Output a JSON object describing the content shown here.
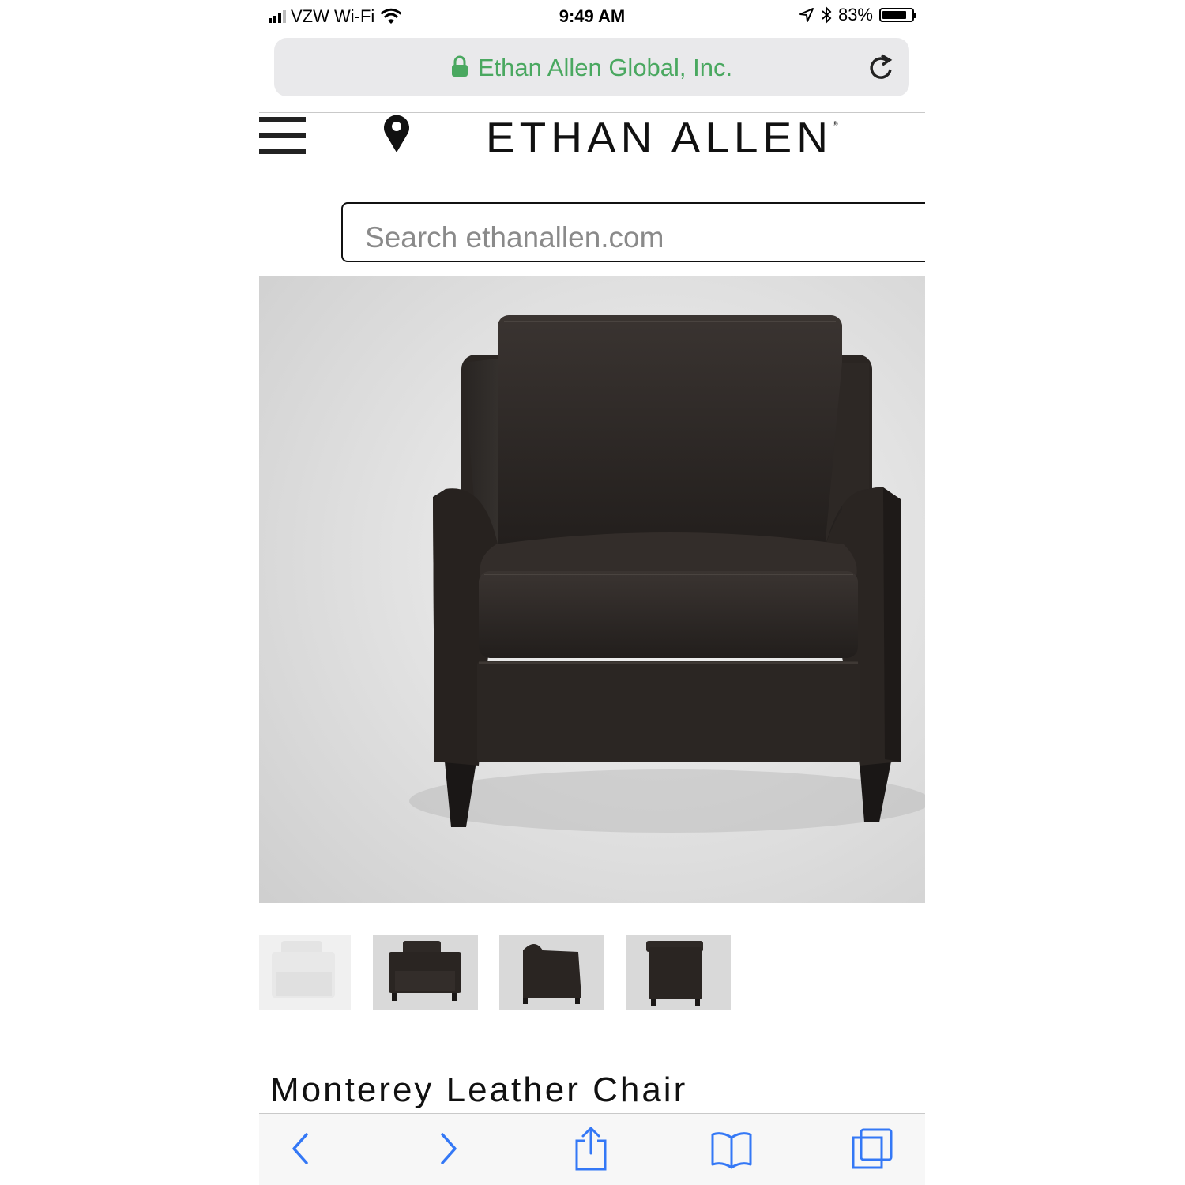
{
  "status_bar": {
    "carrier": "VZW Wi-Fi",
    "time": "9:49 AM",
    "battery": "83%",
    "battery_level": 0.83
  },
  "address_bar": {
    "site_name": "Ethan Allen Global, Inc.",
    "icons": [
      "lock-icon",
      "reload-icon"
    ]
  },
  "header": {
    "brand": "ETHAN ALLEN",
    "trademark": "®",
    "icons": [
      "hamburger-menu-icon",
      "location-pin-icon"
    ]
  },
  "search": {
    "placeholder": "Search ethanallen.com"
  },
  "product": {
    "title": "Monterey Leather Chair",
    "image_alt": "Dark brown leather armchair",
    "thumbnails": [
      "white chair view",
      "front angled view",
      "side view",
      "back view"
    ]
  },
  "toolbar": {
    "icons": [
      "back-icon",
      "forward-icon",
      "share-icon",
      "bookmarks-icon",
      "tabs-icon"
    ]
  },
  "colors": {
    "secure_green": "#4aa860",
    "ios_blue": "#3478f6",
    "leather": "#2e2926"
  }
}
